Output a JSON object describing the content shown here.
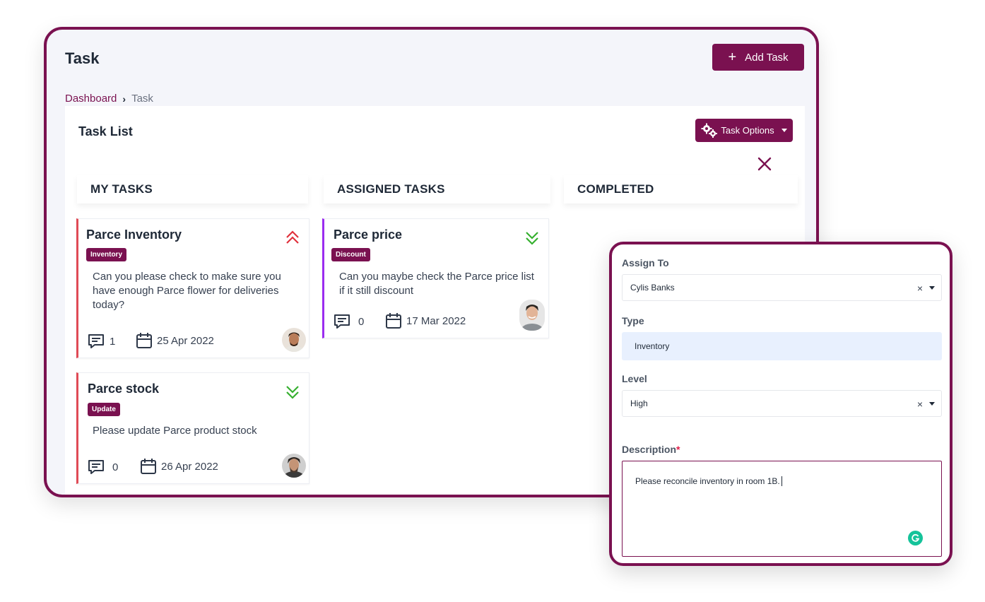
{
  "header": {
    "title": "Task",
    "add_task_label": "Add Task",
    "add_icon": "plus-icon"
  },
  "breadcrumb": {
    "root": "Dashboard",
    "current": "Task"
  },
  "panel": {
    "title": "Task List",
    "options_label": "Task Options"
  },
  "columns": [
    {
      "label": "MY TASKS"
    },
    {
      "label": "ASSIGNED TASKS"
    },
    {
      "label": "COMPLETED"
    }
  ],
  "tasks": [
    {
      "title": "Parce Inventory",
      "tag": "Inventory",
      "description": "Can you please check to make sure you have enough Parce flower for deliveries today?",
      "comments": "1",
      "date": "25 Apr 2022",
      "priority": "high",
      "column": "MY TASKS"
    },
    {
      "title": "Parce stock",
      "tag": "Update",
      "description": "Please update Parce product stock",
      "comments": "0",
      "date": "26 Apr 2022",
      "priority": "low",
      "column": "MY TASKS"
    },
    {
      "title": "Parce price",
      "tag": "Discount",
      "description": "Can you maybe check the Parce price list if it still discount",
      "comments": "0",
      "date": "17 Mar 2022",
      "priority": "low",
      "column": "ASSIGNED TASKS"
    }
  ],
  "form": {
    "assign_label": "Assign To",
    "assign_value": "Cylis Banks",
    "type_label": "Type",
    "type_value": "Inventory",
    "level_label": "Level",
    "level_value": "High",
    "description_label": "Description",
    "required_mark": "*",
    "description_value": "Please reconcile inventory in room 1B.",
    "clear_glyph": "×"
  },
  "colors": {
    "brand": "#7a1150",
    "high_priority": "#e0313c",
    "low_priority": "#36b02f",
    "card_accent": "#e04a55",
    "assigned_accent": "#9b2df0"
  }
}
